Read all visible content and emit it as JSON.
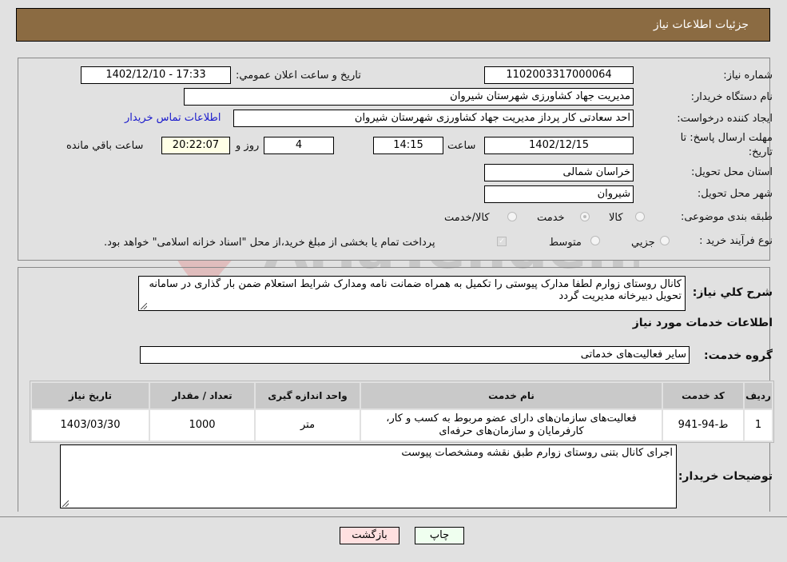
{
  "header": {
    "title": "جزئيات اطلاعات نياز"
  },
  "fields": {
    "need_number_label": "شماره نیاز:",
    "need_number": "1102003317000064",
    "announce_label": "تاريخ و ساعت اعلان عمومي:",
    "announce_value": "1402/12/10 - 17:33",
    "buyer_org_label": "نام دستگاه خریدار:",
    "buyer_org": "مدیریت جهاد کشاورزی شهرستان شیروان",
    "creator_label": "ایجاد کننده درخواست:",
    "creator": "احد سعادتی کار پرداز مدیریت جهاد کشاورزی شهرستان شیروان",
    "contact_link": "اطلاعات تماس خریدار",
    "deadline_label": "مهلت ارسال پاسخ: تا تاریخ:",
    "deadline_date": "1402/12/15",
    "time_label": "ساعت",
    "deadline_time": "14:15",
    "days_value": "4",
    "days_label": "روز و",
    "remaining_time": "20:22:07",
    "remaining_label": "ساعت باقي مانده",
    "province_label": "استان محل تحویل:",
    "province": "خراسان شمالی",
    "city_label": "شهر محل تحویل:",
    "city": "شیروان",
    "category_label": "طبقه بندی موضوعی:",
    "category_options": [
      "کالا",
      "خدمت",
      "کالا/خدمت"
    ],
    "category_selected": "خدمت",
    "process_label": "نوع فرآیند خرید :",
    "process_options": [
      "جزيي",
      "متوسط"
    ],
    "treasury_note": "پرداخت تمام یا بخشی از مبلغ خرید،از محل \"اسناد خزانه اسلامی\" خواهد بود."
  },
  "description": {
    "label": "شرح کلي نياز:",
    "text": "کانال روستای زوارم لطفا مدارک پیوستی را تکمیل به همراه ضمانت نامه ومدارک شرایط استعلام ضمن بار گذاری در سامانه تحویل دبیرخانه مدیریت گردد"
  },
  "services": {
    "section_title": "اطلاعات خدمات مورد نیاز",
    "group_label": "گروه خدمت:",
    "group_value": "سایر فعالیت‌های خدماتی",
    "columns": [
      "رديف",
      "کد خدمت",
      "نام خدمت",
      "واحد اندازه گیری",
      "تعداد / مقدار",
      "تاریخ نیاز"
    ],
    "rows": [
      {
        "index": "1",
        "code": "ط-94-941",
        "name": "فعالیت‌های سازمان‌های دارای عضو مربوط به کسب و کار، کارفرمایان و سازمان‌های حرفه‌ای",
        "unit": "متر",
        "quantity": "1000",
        "date": "1403/03/30"
      }
    ]
  },
  "buyer_notes": {
    "label": "توضیحات خریدار:",
    "text": "اجرای کانال بتنی روستای زوارم طبق نقشه ومشخصات پیوست"
  },
  "buttons": {
    "print": "چاپ",
    "back": "بازگشت"
  },
  "watermark": {
    "text": "AriaTender.neT"
  },
  "colors": {
    "header_bg": "#8b6b42",
    "print_bg": "#efffef",
    "back_bg": "#ffe0e0",
    "link": "#1a1acc"
  }
}
